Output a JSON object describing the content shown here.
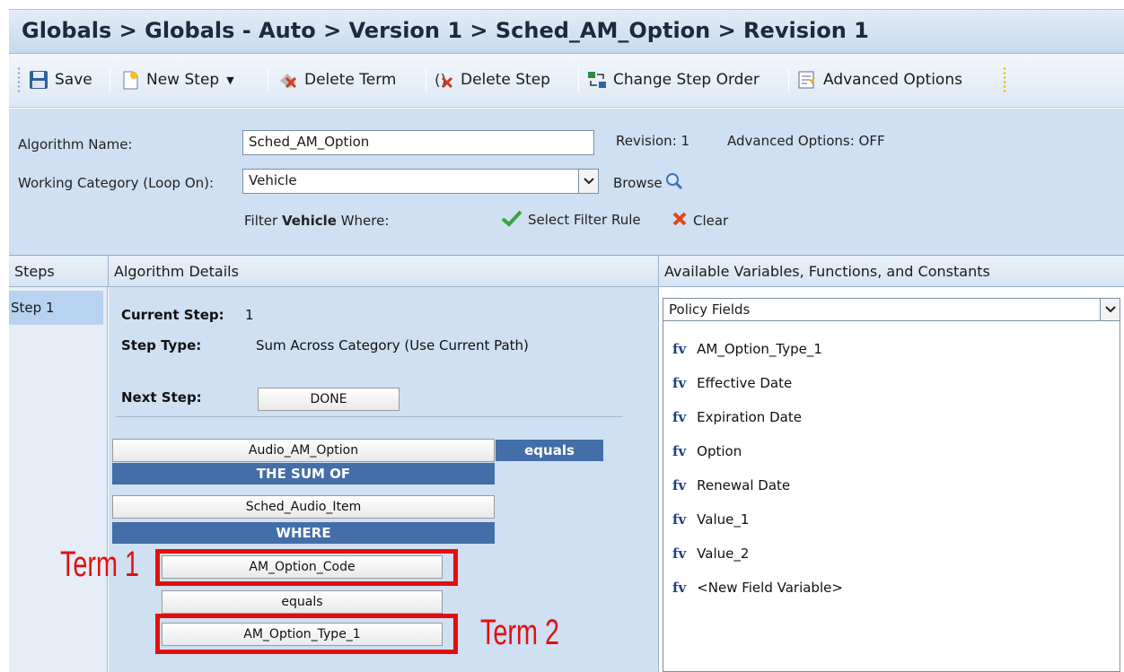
{
  "breadcrumb": "Globals > Globals - Auto > Version 1 > Sched_AM_Option > Revision 1",
  "toolbar": {
    "save": "Save",
    "new_step": "New Step",
    "delete_term": "Delete Term",
    "delete_step": "Delete Step",
    "change_step_order": "Change Step Order",
    "advanced_options": "Advanced Options"
  },
  "form": {
    "algorithm_name_label": "Algorithm Name:",
    "algorithm_name_value": "Sched_AM_Option",
    "revision": "Revision: 1",
    "advanced_options_status": "Advanced Options: OFF",
    "working_category_label": "Working Category (Loop On):",
    "working_category_value": "Vehicle",
    "browse": "Browse",
    "filter_prefix": "Filter",
    "filter_category": "Vehicle",
    "filter_suffix": "Where:",
    "select_filter_rule": "Select Filter Rule",
    "clear": "Clear"
  },
  "headers": {
    "steps": "Steps",
    "algorithm_details": "Algorithm Details",
    "available": "Available Variables, Functions, and Constants"
  },
  "steps": [
    "Step 1"
  ],
  "details": {
    "current_step_label": "Current Step:",
    "current_step_value": "1",
    "step_type_label": "Step Type:",
    "step_type_value": "Sum Across Category (Use Current Path)",
    "next_step_label": "Next Step:",
    "next_step_value": "DONE",
    "result_var": "Audio_AM_Option",
    "equals_band": "equals",
    "sum_of_band": "THE SUM OF",
    "sum_var": "Sched_Audio_Item",
    "where_band": "WHERE",
    "term1_var": "AM_Option_Code",
    "operator": "equals",
    "term2_var": "AM_Option_Type_1",
    "term1_annotation": "Term 1",
    "term2_annotation": "Term 2"
  },
  "variables": {
    "selected_source": "Policy Fields",
    "items": [
      "AM_Option_Type_1",
      "Effective Date",
      "Expiration Date",
      "Option",
      "Renewal Date",
      "Value_1",
      "Value_2",
      "<New Field Variable>"
    ],
    "item_prefix": "fv"
  },
  "colors": {
    "band": "#436ea8",
    "annotation_red": "#e01010",
    "panel_bg": "#cfe0f3"
  }
}
